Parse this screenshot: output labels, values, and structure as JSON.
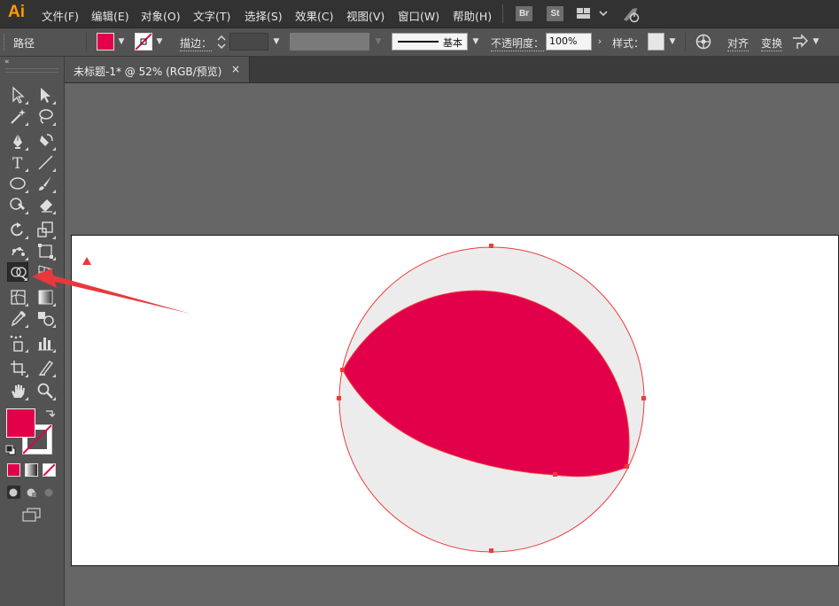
{
  "app": {
    "logo": "Ai"
  },
  "menu": [
    "文件(F)",
    "编辑(E)",
    "对象(O)",
    "文字(T)",
    "选择(S)",
    "效果(C)",
    "视图(V)",
    "窗口(W)",
    "帮助(H)"
  ],
  "menubar_badges": {
    "bridge": "Br",
    "stock": "St"
  },
  "controlbar": {
    "selection_label": "路径",
    "stroke_label": "描边：",
    "stroke_style": "基本",
    "opacity_label": "不透明度：",
    "opacity_value": "100%",
    "style_label": "样式：",
    "align_label": "对齐",
    "transform_label": "变换"
  },
  "colors": {
    "fill": "#e2004a",
    "path_highlight": "#ef3b3b",
    "circle_bottom": "#ececec",
    "arrow": "#e8383d"
  },
  "tools": [
    [
      "selection-tool",
      "direct-selection-tool"
    ],
    [
      "magic-wand-tool",
      "lasso-tool"
    ],
    [
      "pen-tool",
      "curvature-tool"
    ],
    [
      "type-tool",
      "line-segment-tool"
    ],
    [
      "ellipse-tool",
      "paintbrush-tool"
    ],
    [
      "shaper-tool",
      "eraser-tool"
    ],
    [
      "rotate-tool",
      "scale-tool"
    ],
    [
      "puppet-warp-tool",
      "free-transform-tool"
    ],
    [
      "shape-builder-tool",
      "perspective-grid-tool"
    ],
    [
      "mesh-tool",
      "gradient-tool"
    ],
    [
      "eyedropper-tool",
      "blend-tool"
    ],
    [
      "symbol-sprayer-tool",
      "column-graph-tool"
    ],
    [
      "artboard-tool",
      "slice-tool"
    ],
    [
      "hand-tool",
      "zoom-tool"
    ]
  ],
  "document": {
    "tab_title": "未标题-1* @ 52% (RGB/预览)",
    "close_glyph": "×"
  }
}
